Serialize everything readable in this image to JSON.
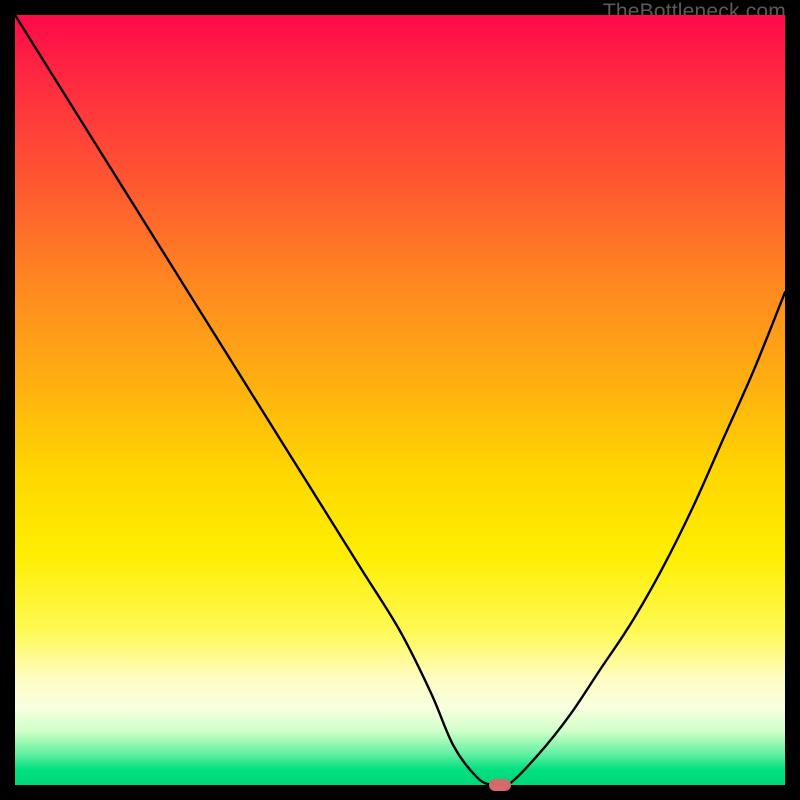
{
  "watermark": "TheBottleneck.com",
  "chart_data": {
    "type": "line",
    "title": "",
    "xlabel": "",
    "ylabel": "",
    "xlim": [
      0,
      100
    ],
    "ylim": [
      0,
      100
    ],
    "series": [
      {
        "name": "bottleneck-curve",
        "x": [
          0,
          5,
          10,
          15,
          20,
          25,
          30,
          35,
          40,
          45,
          50,
          54,
          57,
          60,
          62,
          64,
          68,
          72,
          76,
          80,
          84,
          88,
          92,
          96,
          100
        ],
        "values": [
          100,
          92,
          84,
          76,
          68,
          60,
          52,
          44,
          36,
          28,
          20,
          12,
          5,
          1,
          0,
          0,
          4,
          9,
          15,
          21,
          28,
          36,
          45,
          54,
          64
        ]
      }
    ],
    "marker": {
      "x": 63,
      "y": 0
    },
    "gradient_stops": [
      {
        "pos": 0,
        "color": "#ff0a4a"
      },
      {
        "pos": 50,
        "color": "#ffd000"
      },
      {
        "pos": 90,
        "color": "#fffcc0"
      },
      {
        "pos": 100,
        "color": "#00d878"
      }
    ]
  }
}
